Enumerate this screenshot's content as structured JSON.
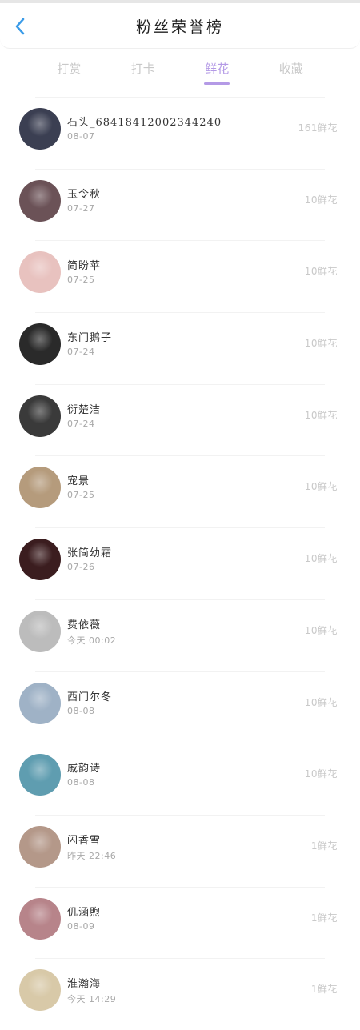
{
  "header": {
    "title": "粉丝荣誉榜"
  },
  "tabs": [
    {
      "label": "打赏",
      "active": false
    },
    {
      "label": "打卡",
      "active": false
    },
    {
      "label": "鲜花",
      "active": true
    },
    {
      "label": "收藏",
      "active": false
    }
  ],
  "colors": {
    "accent": "#b49ae6",
    "back_arrow": "#3a9be8"
  },
  "list": [
    {
      "name": "石头_68418412002344240",
      "date": "08-07",
      "count": "161鲜花",
      "avatar_color": "#3b3f52"
    },
    {
      "name": "玉令秋",
      "date": "07-27",
      "count": "10鲜花",
      "avatar_color": "#6b5257"
    },
    {
      "name": "简盼苹",
      "date": "07-25",
      "count": "10鲜花",
      "avatar_color": "#e8c2bf"
    },
    {
      "name": "东门鹅子",
      "date": "07-24",
      "count": "10鲜花",
      "avatar_color": "#2a2a2a"
    },
    {
      "name": "衍楚洁",
      "date": "07-24",
      "count": "10鲜花",
      "avatar_color": "#3a3a3a"
    },
    {
      "name": "宠景",
      "date": "07-25",
      "count": "10鲜花",
      "avatar_color": "#b59b7c"
    },
    {
      "name": "张简幼霜",
      "date": "07-26",
      "count": "10鲜花",
      "avatar_color": "#3b1d1f"
    },
    {
      "name": "费依薇",
      "date": "今天 00:02",
      "count": "10鲜花",
      "avatar_color": "#bcbcbc"
    },
    {
      "name": "西门尔冬",
      "date": "08-08",
      "count": "10鲜花",
      "avatar_color": "#9fb2c6"
    },
    {
      "name": "戚韵诗",
      "date": "08-08",
      "count": "10鲜花",
      "avatar_color": "#5f9db0"
    },
    {
      "name": "闪香雪",
      "date": "昨天 22:46",
      "count": "1鲜花",
      "avatar_color": "#b49889"
    },
    {
      "name": "仉涵煦",
      "date": "08-09",
      "count": "1鲜花",
      "avatar_color": "#b7848a"
    },
    {
      "name": "淮瀚海",
      "date": "今天 14:29",
      "count": "1鲜花",
      "avatar_color": "#d8c9a8"
    }
  ]
}
